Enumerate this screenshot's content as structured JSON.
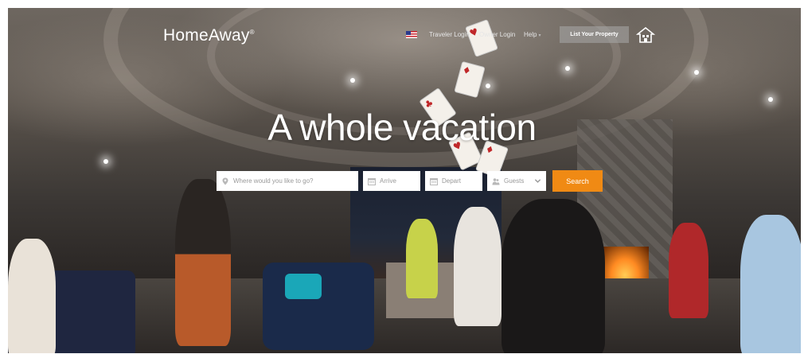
{
  "header": {
    "logo_text": "HomeAway",
    "logo_mark": "®",
    "flag_icon": "us-flag-icon",
    "nav": {
      "traveler_login": "Traveler Login",
      "owner_login": "Owner Login",
      "help": "Help"
    },
    "list_property_label": "List Your Property",
    "house_icon": "house-icon"
  },
  "hero": {
    "headline": "A whole vacation"
  },
  "search": {
    "where_placeholder": "Where would you like to go?",
    "arrive_placeholder": "Arrive",
    "depart_placeholder": "Depart",
    "guests_placeholder": "Guests",
    "submit_label": "Search"
  },
  "colors": {
    "accent_orange": "#f08a14",
    "text_white": "#ffffff",
    "field_placeholder": "#9a9a9a"
  }
}
